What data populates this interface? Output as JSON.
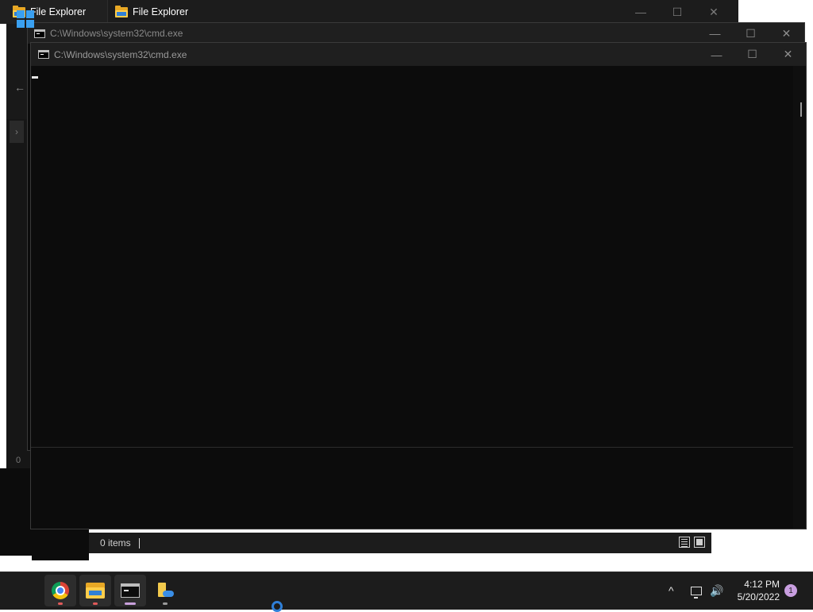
{
  "explorer_tabs": [
    {
      "label": "File Explorer"
    },
    {
      "label": "File Explorer"
    }
  ],
  "explorer": {
    "side_count": "0",
    "status_text": "0 items"
  },
  "cmd_windows": [
    {
      "title": "C:\\Windows\\system32\\cmd.exe"
    },
    {
      "title": "C:\\Windows\\system32\\cmd.exe"
    }
  ],
  "window_controls": {
    "minimize": "—",
    "maximize": "☐",
    "close": "✕"
  },
  "taskbar": {
    "items": [
      {
        "icon": "windows-start-icon"
      },
      {
        "icon": "chrome-icon"
      },
      {
        "icon": "file-explorer-icon"
      },
      {
        "icon": "terminal-icon"
      },
      {
        "icon": "file-explorer-onedrive-icon"
      }
    ],
    "tray_chevron": "^",
    "volume_glyph": "🔊",
    "time": "4:12 PM",
    "date": "5/20/2022",
    "notification_count": "1"
  },
  "colors": {
    "console_bg": "#0c0c0c",
    "titlebar_bg": "#1f1f1f",
    "taskbar_bg": "#1c1c1c",
    "accent_blue": "#3aa0f0",
    "notification_badge": "#c99fe0"
  }
}
